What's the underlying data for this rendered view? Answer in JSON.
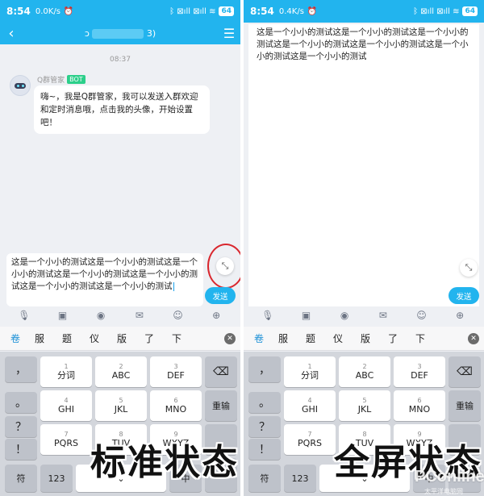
{
  "status_left": {
    "time": "8:54",
    "speed": "0.0K/s",
    "alarm": "⏰",
    "signal": "ᛒ ⊠ıll ⊠ıll ≋",
    "battery": "64"
  },
  "status_right": {
    "time": "8:54",
    "speed": "0.4K/s",
    "alarm": "⏰",
    "signal": "ᛒ ⊠ıll ⊠ıll ≋",
    "battery": "64"
  },
  "titlebar": {
    "back": "‹",
    "title_prefix": "ɔ",
    "title_suffix": "3)",
    "menu": "☰"
  },
  "chat": {
    "time": "08:37",
    "sender": "Q群管家",
    "badge": "BOT",
    "message": "嗨~，我是Q群管家，我可以发送入群欢迎和定时消息哦，点击我的头像，开始设置吧！"
  },
  "input": {
    "text": "这是一个小小的测试这是一个小小的测试这是一个小小的测试这是一个小小的测试这是一个小小的测试这是一个小小的测试这是一个小小的测试",
    "send": "发送",
    "expand_icon": "⤡"
  },
  "toolbar_icons": [
    "mic-icon",
    "image-icon",
    "camera-icon",
    "red-packet-icon",
    "emoji-icon",
    "plus-icon"
  ],
  "candidates": {
    "first": "卷",
    "items": [
      "服",
      "题",
      "仪",
      "版",
      "了",
      "下"
    ],
    "close": "✕"
  },
  "keyboard": {
    "rows": [
      {
        "side": "，",
        "keys": [
          {
            "n": "1",
            "l": "分词"
          },
          {
            "n": "2",
            "l": "ABC"
          },
          {
            "n": "3",
            "l": "DEF"
          }
        ],
        "action": "⌫"
      },
      {
        "side": "。",
        "keys": [
          {
            "n": "4",
            "l": "GHI"
          },
          {
            "n": "5",
            "l": "JKL"
          },
          {
            "n": "6",
            "l": "MNO"
          }
        ],
        "action": "重输"
      },
      {
        "side": "？",
        "keys": [
          {
            "n": "7",
            "l": "PQRS"
          },
          {
            "n": "8",
            "l": "TUV"
          },
          {
            "n": "9",
            "l": "WXYZ"
          }
        ],
        "action": ""
      }
    ],
    "side_extra": "！",
    "bottom": {
      "sym": "符",
      "num": "123",
      "mic": "⌄",
      "space": "中",
      "enter": "↵"
    }
  },
  "captions": {
    "left": "标准状态",
    "right": "全屏状态"
  },
  "watermark": {
    "main": "PConline",
    "sub": "太平洋电脑网"
  }
}
